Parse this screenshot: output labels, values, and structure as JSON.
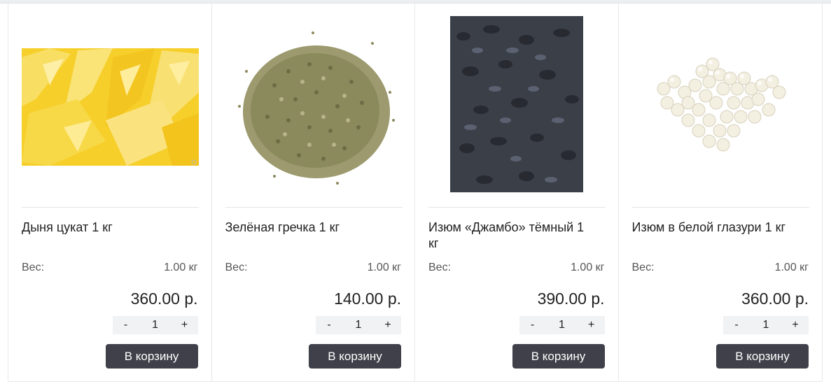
{
  "products": [
    {
      "name": "Дыня цукат 1 кг",
      "weight_label": "Вес:",
      "weight_value": "1.00 кг",
      "price": "360.00 р.",
      "qty": "1",
      "minus": "-",
      "plus": "+",
      "cart_label": "В корзину",
      "image": "candied-melon-image"
    },
    {
      "name": "Зелёная гречка 1 кг",
      "weight_label": "Вес:",
      "weight_value": "1.00 кг",
      "price": "140.00 р.",
      "qty": "1",
      "minus": "-",
      "plus": "+",
      "cart_label": "В корзину",
      "image": "green-buckwheat-image"
    },
    {
      "name": "Изюм «Джамбо» тёмный 1 кг",
      "weight_label": "Вес:",
      "weight_value": "1.00 кг",
      "price": "390.00 р.",
      "qty": "1",
      "minus": "-",
      "plus": "+",
      "cart_label": "В корзину",
      "image": "dark-raisins-image"
    },
    {
      "name": "Изюм в белой глазури 1 кг",
      "weight_label": "Вес:",
      "weight_value": "1.00 кг",
      "price": "360.00 р.",
      "qty": "1",
      "minus": "-",
      "plus": "+",
      "cart_label": "В корзину",
      "image": "glazed-raisins-image"
    }
  ],
  "colors": {
    "cart_button": "#3f4049",
    "stepper_bg": "#f1f2f4",
    "divider": "#e4e6e8"
  }
}
